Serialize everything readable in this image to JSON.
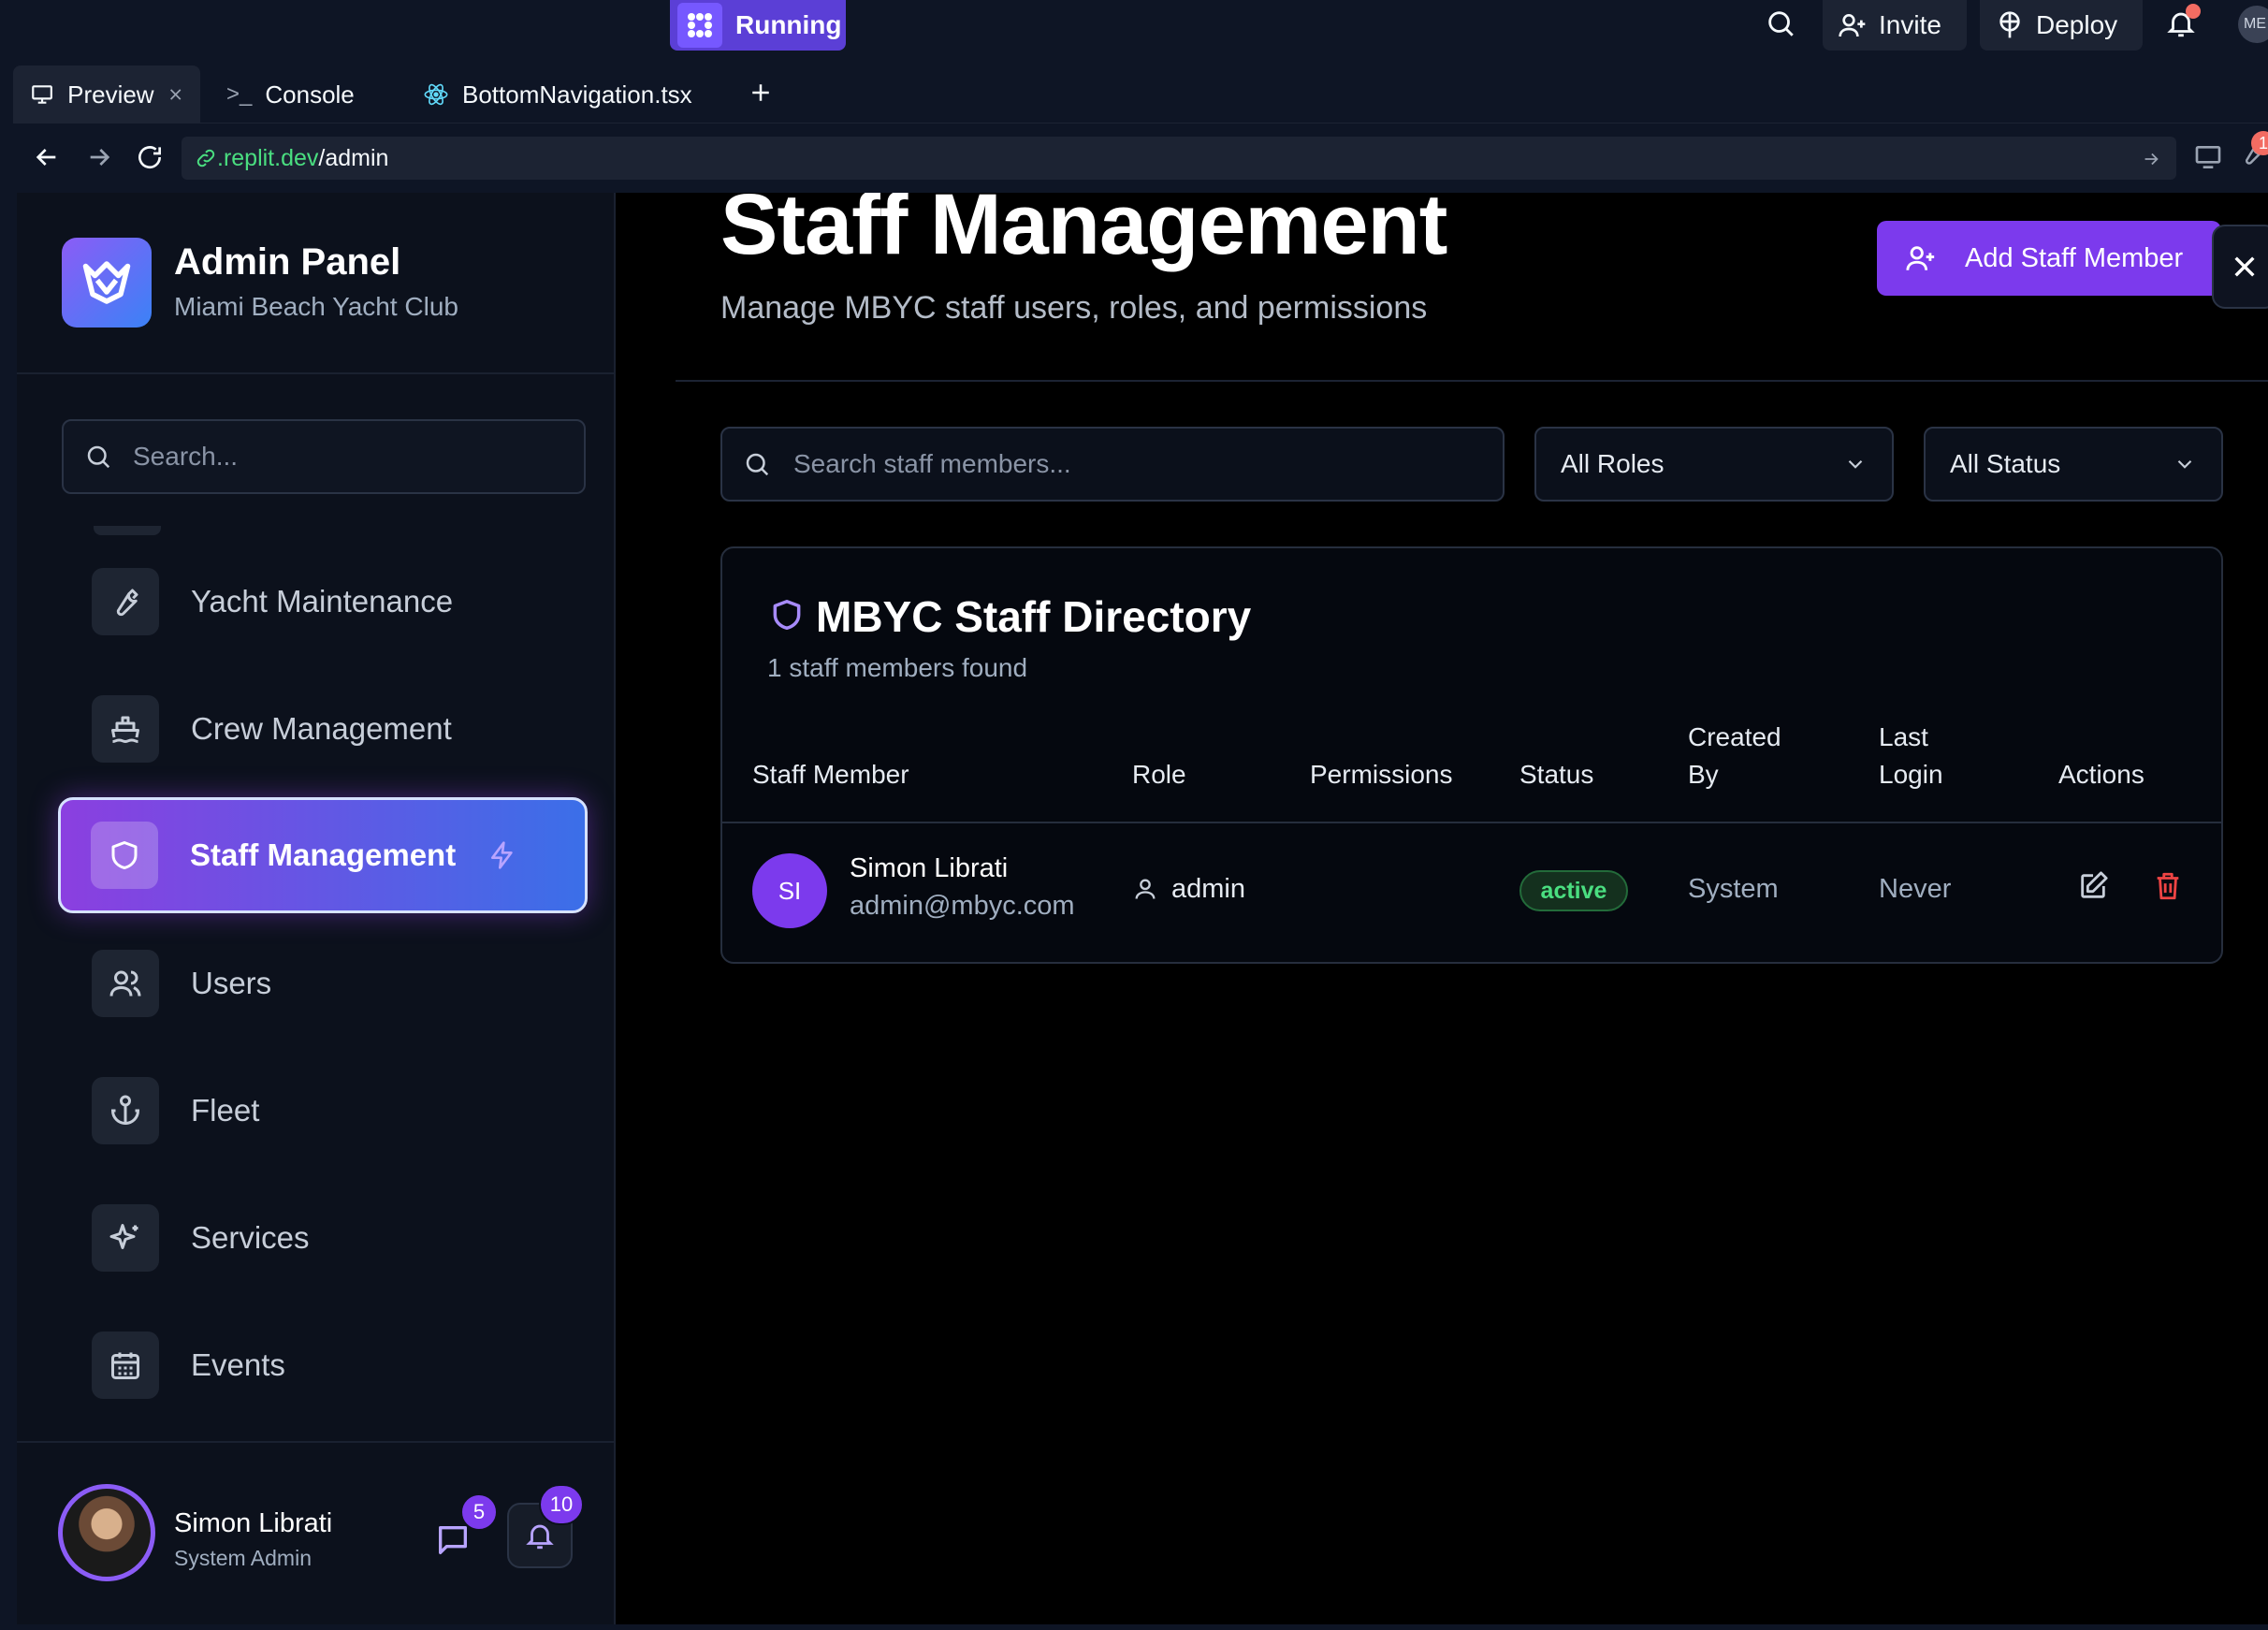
{
  "replit": {
    "run_label": "Running",
    "invite_label": "Invite",
    "deploy_label": "Deploy",
    "profile_initials": "ME",
    "devtools_badge": "1",
    "tabs": [
      {
        "label": "Preview"
      },
      {
        "label": "Console"
      },
      {
        "label": "BottomNavigation.tsx"
      }
    ],
    "url_host": ".replit.dev",
    "url_path": "/admin"
  },
  "sidebar": {
    "brand_title": "Admin Panel",
    "brand_subtitle": "Miami Beach Yacht Club",
    "search_placeholder": "Search...",
    "items": [
      {
        "label": "Yacht Maintenance",
        "icon": "wrench-icon"
      },
      {
        "label": "Crew Management",
        "icon": "ship-icon"
      },
      {
        "label": "Staff Management",
        "icon": "shield-icon",
        "active": true
      },
      {
        "label": "Users",
        "icon": "users-icon"
      },
      {
        "label": "Fleet",
        "icon": "anchor-icon"
      },
      {
        "label": "Services",
        "icon": "sparkles-icon"
      },
      {
        "label": "Events",
        "icon": "calendar-icon"
      }
    ],
    "user": {
      "name": "Simon Librati",
      "role": "System Admin",
      "messages_count": "5",
      "notifications_count": "10"
    }
  },
  "main": {
    "title": "Staff Management",
    "subtitle": "Manage MBYC staff users, roles, and permissions",
    "add_button": "Add Staff Member",
    "search_placeholder": "Search staff members...",
    "role_filter": "All Roles",
    "status_filter": "All Status",
    "directory": {
      "title": "MBYC Staff Directory",
      "count_text": "1 staff members found",
      "columns": {
        "member": "Staff Member",
        "role": "Role",
        "permissions": "Permissions",
        "status": "Status",
        "created_by_1": "Created",
        "created_by_2": "By",
        "last_login_1": "Last",
        "last_login_2": "Login",
        "actions": "Actions"
      },
      "rows": [
        {
          "initials": "SI",
          "name": "Simon Librati",
          "email": "admin@mbyc.com",
          "role": "admin",
          "permissions": "",
          "status": "active",
          "created_by": "System",
          "last_login": "Never"
        }
      ]
    }
  },
  "colors": {
    "accent": "#7c3aed",
    "active_gradient_start": "#8b3fe0",
    "active_gradient_end": "#3b6fe8",
    "status_active": "#4ade80",
    "delete": "#ef4444"
  }
}
